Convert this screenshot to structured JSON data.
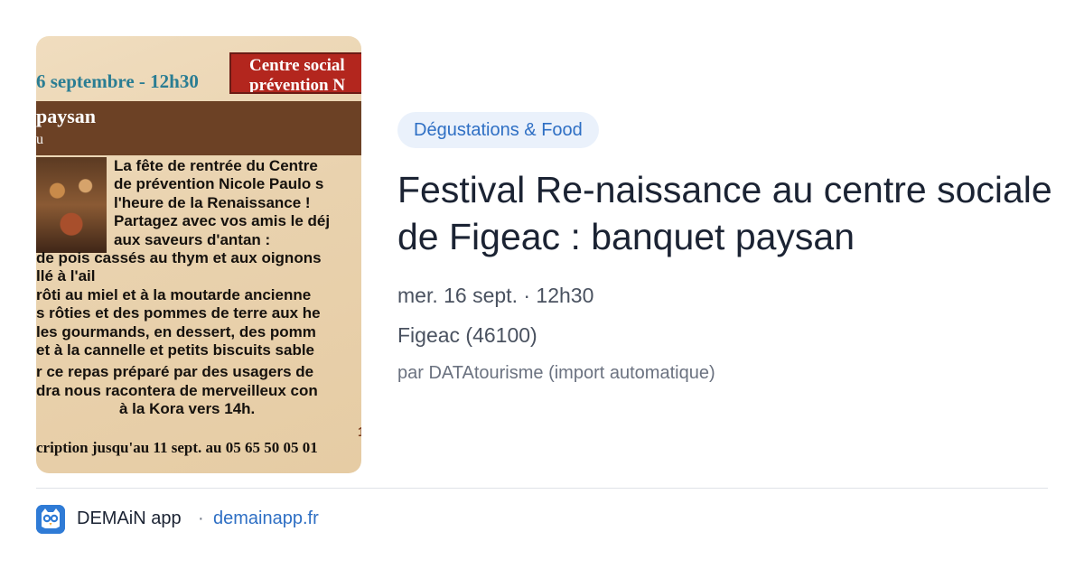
{
  "poster": {
    "date_line": "6 septembre - 12h30",
    "org_line1": "Centre social",
    "org_line2": "prévention N",
    "band_title": "paysan",
    "band_sub": "u",
    "body_lines": [
      "La fête de rentrée du Centre",
      "de prévention Nicole Paulo s",
      "l'heure de la Renaissance !",
      "Partagez avec vos amis le déj",
      "aux saveurs d'antan :",
      "de pois cassés au thym et aux oignons",
      "llé à l'ail",
      "rôti au miel et à la moutarde ancienne",
      "s rôties et des pommes de terre aux he",
      "les gourmands, en dessert, des pomm",
      "et à la cannelle et petits biscuits sable",
      "r ce repas préparé par des usagers de",
      "dra nous racontera de merveilleux con",
      "à la Kora vers 14h."
    ],
    "footer": "cription jusqu'au 11 sept. au 05 65 50 05 01",
    "mark": "1"
  },
  "event": {
    "category": "Dégustations & Food",
    "title": "Festival Re-naissance au centre sociale de Figeac : banquet paysan",
    "date": "mer. 16 sept. · 12h30",
    "location": "Figeac (46100)",
    "source": "par DATAtourisme (import automatique)"
  },
  "footer": {
    "app_name": "DEMAiN app",
    "separator": "·",
    "domain": "demainapp.fr",
    "logo_icon": "owl-logo-icon"
  },
  "colors": {
    "badge_bg": "#eaf1fb",
    "accent_blue": "#2e6fc4",
    "title_text": "#1b2333",
    "poster_band": "#6c4125",
    "poster_red": "#b3261e"
  }
}
